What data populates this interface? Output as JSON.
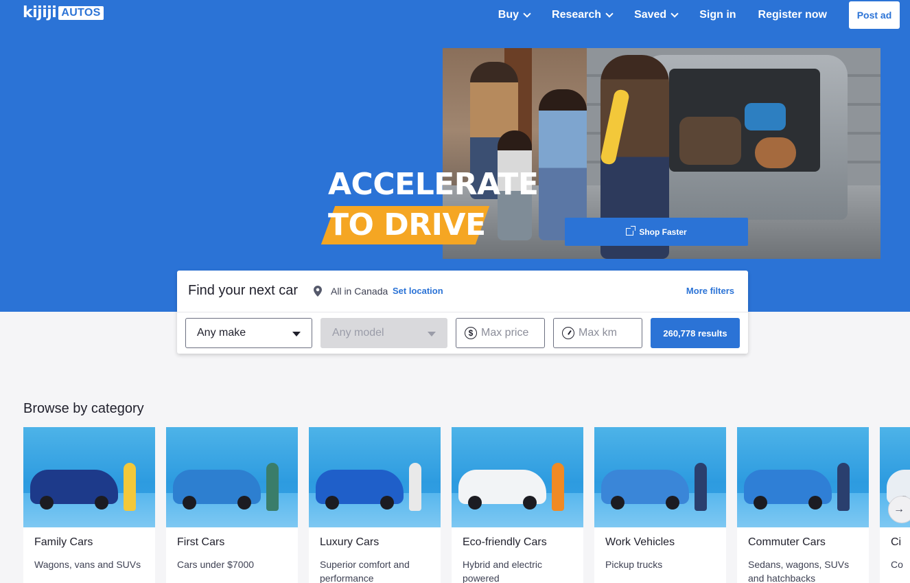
{
  "header": {
    "logo_main": "kijiji",
    "logo_sub": "AUTOS",
    "nav": [
      {
        "label": "Buy",
        "has_dropdown": true
      },
      {
        "label": "Research",
        "has_dropdown": true
      },
      {
        "label": "Saved",
        "has_dropdown": true
      },
      {
        "label": "Sign in",
        "has_dropdown": false
      },
      {
        "label": "Register now",
        "has_dropdown": false
      }
    ],
    "post_ad_label": "Post ad"
  },
  "hero": {
    "headline_line1": "ACCELERATE",
    "headline_line2": "TO DRIVE",
    "cta_label": "Shop Faster"
  },
  "search": {
    "title": "Find your next car",
    "location_text": "All in Canada",
    "set_location_label": "Set location",
    "more_filters_label": "More filters",
    "make_value": "Any make",
    "model_value": "Any model",
    "price_placeholder": "Max price",
    "km_placeholder": "Max km",
    "results_label": "260,778 results"
  },
  "browse": {
    "title": "Browse by category",
    "categories": [
      {
        "name": "Family Cars",
        "description": "Wagons, vans and SUVs",
        "car_color": "#1d3a8a",
        "figure_color": "#f3c83a"
      },
      {
        "name": "First Cars",
        "description": "Cars under $7000",
        "car_color": "#2d7fd0",
        "figure_color": "#3a7d6a"
      },
      {
        "name": "Luxury Cars",
        "description": "Superior comfort and performance",
        "car_color": "#1f5fc9",
        "figure_color": "#e9e9e9"
      },
      {
        "name": "Eco-friendly Cars",
        "description": "Hybrid and electric powered",
        "car_color": "#f2f4f6",
        "figure_color": "#f08a24"
      },
      {
        "name": "Work Vehicles",
        "description": "Pickup trucks",
        "car_color": "#3a86d8",
        "figure_color": "#2a3f6e"
      },
      {
        "name": "Commuter Cars",
        "description": "Sedans, wagons, SUVs and hatchbacks",
        "car_color": "#2f7fd6",
        "figure_color": "#2a3f6e"
      },
      {
        "name": "Ci",
        "description": "Co",
        "car_color": "#e9eef3",
        "figure_color": "#e9eef3"
      }
    ],
    "next_arrow": "→"
  },
  "colors": {
    "brand_blue": "#2b73d6",
    "accent_orange": "#f5a623"
  },
  "icons": {
    "external_link": "external-link-icon",
    "location_pin": "location-pin-icon",
    "dollar": "dollar-icon",
    "odometer": "odometer-icon",
    "arrow_right": "arrow-right-icon"
  }
}
